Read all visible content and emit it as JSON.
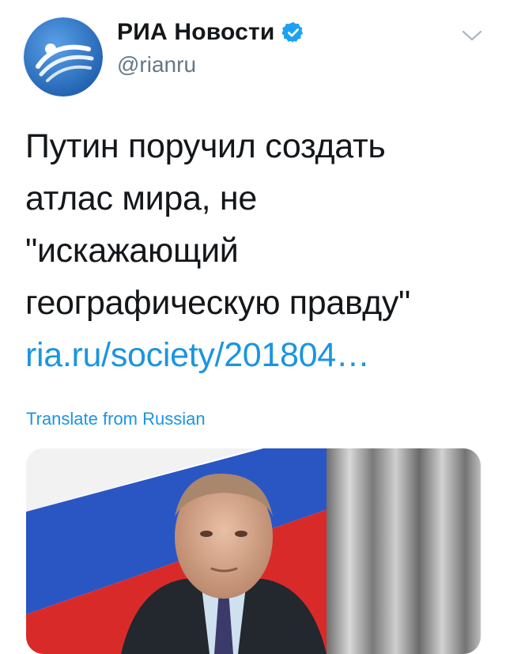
{
  "account": {
    "name": "РИА Новости",
    "handle": "@rianru",
    "verified": true,
    "avatar_icon": "ria-logo-icon",
    "avatar_color": "#2f6fbe"
  },
  "tweet": {
    "lines": [
      "Путин поручил создать",
      "атлас мира, не",
      "\"искажающий",
      "географическую правду\""
    ],
    "link": "ria.ru/society/201804…"
  },
  "translate_label": "Translate from Russian",
  "colors": {
    "link": "#1b95e0",
    "text": "#14171a",
    "secondary": "#657786"
  },
  "media": {
    "icon": "photo-icon"
  }
}
